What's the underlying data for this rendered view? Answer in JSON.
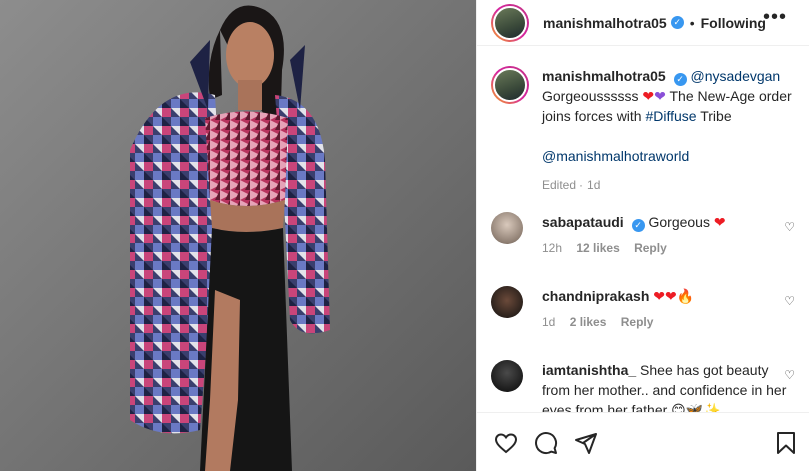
{
  "header": {
    "username": "manishmalhotra05",
    "following_label": "Following",
    "more_label": "•••"
  },
  "caption": {
    "username": "manishmalhotra05",
    "mention": "@nysadevgan",
    "text_1": "Gorgeoussssss",
    "text_2": "The New-Age order joins forces with",
    "hashtag": "#Diffuse",
    "text_3": "Tribe",
    "mention_2": "@manishmalhotraworld",
    "edited": "Edited",
    "time": "1d"
  },
  "comments": [
    {
      "username": "sabapataudi",
      "text": "Gorgeous",
      "time": "12h",
      "likes": "12 likes",
      "reply": "Reply"
    },
    {
      "username": "chandniprakash",
      "text": "",
      "time": "1d",
      "likes": "2 likes",
      "reply": "Reply"
    },
    {
      "username": "iamtanishtha_",
      "text": "Shee has got beauty from her mother.. and confidence in her eyes from her father"
    }
  ],
  "icons": [
    "more-icon",
    "verified-icon",
    "heart-icon",
    "comment-icon",
    "share-icon",
    "bookmark-icon"
  ]
}
